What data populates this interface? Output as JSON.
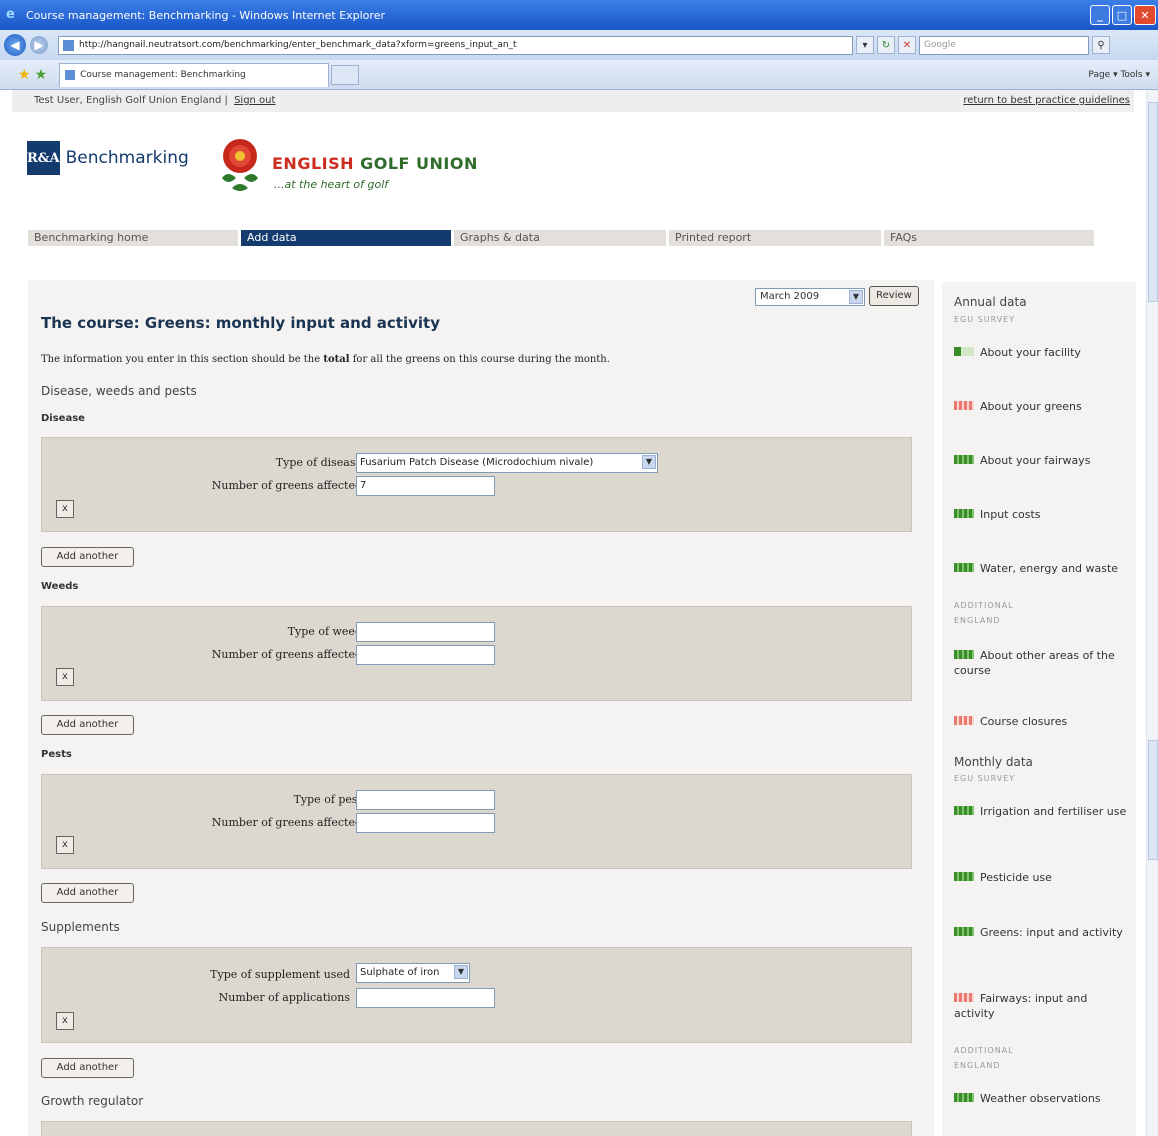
{
  "browser": {
    "window_title": "Course management: Benchmarking - Windows Internet Explorer",
    "address": "http://hangnail.neutratsort.com/benchmarking/enter_benchmark_data?xform=greens_input_an_t",
    "search_placeholder": "Google",
    "tab_title": "Course management: Benchmarking",
    "command_bar": "Page ▾   Tools ▾"
  },
  "userbar": {
    "user": "Test User, English Golf Union England  |",
    "sign_out": "Sign out",
    "return_link": "return to best practice guidelines"
  },
  "branding": {
    "ra_mark": "R&A",
    "ra_text": "Benchmarking",
    "egu_title_red": "ENGLISH",
    "egu_title_rest": " GOLF UNION",
    "egu_tagline": "...at the heart of golf"
  },
  "nav": {
    "items": [
      "Benchmarking home",
      "Add data",
      "Graphs & data",
      "Printed report",
      "FAQs"
    ],
    "active": "Add data"
  },
  "form": {
    "month": "March 2009",
    "review_label": "Review",
    "title": "The course: Greens: monthly input and activity",
    "intro_before": "The information you enter in this section should be the ",
    "intro_bold": "total",
    "intro_after": " for all the greens on this course during the month.",
    "sections": {
      "disease_weeds_pests": "Disease, weeds and pests",
      "supplements": "Supplements",
      "growth_regulator": "Growth regulator"
    },
    "disease": {
      "heading": "Disease",
      "type_label": "Type of disease",
      "type_value": "Fusarium Patch Disease (Microdochium nivale)",
      "count_label": "Number of greens affected",
      "count_value": "7"
    },
    "weeds": {
      "heading": "Weeds",
      "type_label": "Type of weed",
      "type_value": "",
      "count_label": "Number of greens affected",
      "count_value": ""
    },
    "pests": {
      "heading": "Pests",
      "type_label": "Type of pest",
      "type_value": "",
      "count_label": "Number of greens affected",
      "count_value": ""
    },
    "supplement": {
      "type_label": "Type of supplement used",
      "type_value": "Sulphate of iron",
      "count_label": "Number of applications",
      "count_value": ""
    },
    "remove_label": "x",
    "add_another_label": "Add another"
  },
  "sidebar": {
    "annual_heading": "Annual data",
    "annual_sub": "EGU SURVEY",
    "annual_items": [
      "About your facility",
      "About your greens",
      "About your fairways",
      "Input costs",
      "Water, energy and waste"
    ],
    "additional_1": "ADDITIONAL",
    "additional_2": "ENGLAND",
    "additional_items": [
      "About other areas of the course",
      "Course closures"
    ],
    "monthly_heading": "Monthly data",
    "monthly_sub": "EGU SURVEY",
    "monthly_items": [
      "Irrigation and fertiliser use",
      "Pesticide use",
      "Greens: input and activity",
      "Fairways: input and activity"
    ],
    "monthly_additional_1": "ADDITIONAL",
    "monthly_additional_2": "ENGLAND",
    "monthly_additional_items": [
      "Weather observations"
    ],
    "status_colors": {
      "complete": "#3a8b2a",
      "incomplete": "#e97a72"
    }
  }
}
